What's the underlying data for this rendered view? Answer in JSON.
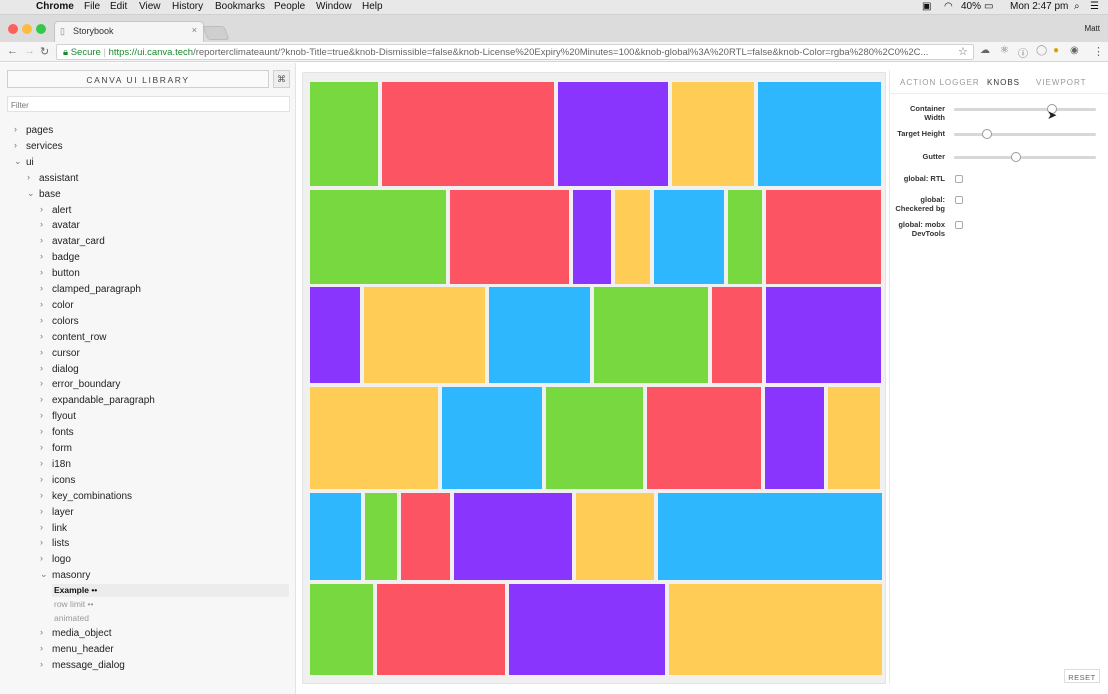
{
  "menubar": {
    "app": "Chrome",
    "menus": [
      "File",
      "Edit",
      "View",
      "History",
      "Bookmarks",
      "People",
      "Window",
      "Help"
    ],
    "battery": "40%",
    "clock": "Mon 2:47 pm",
    "user": "Matt"
  },
  "browser": {
    "tab_title": "Storybook",
    "secure_label": "Secure",
    "url_host": "https://ui.canva.tech",
    "url_path": "/reporterclimateaunt/?knob-Title=true&knob-Dismissible=false&knob-License%20Expiry%20Minutes=100&knob-global%3A%20RTL=false&knob-Color=rgba%280%2C0%2C..."
  },
  "sidebar": {
    "library_label": "CANVA UI LIBRARY",
    "shortcut_label": "⌘",
    "filter_placeholder": "Filter",
    "tree": [
      {
        "label": "pages",
        "depth": 0,
        "open": false
      },
      {
        "label": "services",
        "depth": 0,
        "open": false
      },
      {
        "label": "ui",
        "depth": 0,
        "open": true
      },
      {
        "label": "assistant",
        "depth": 1,
        "open": false
      },
      {
        "label": "base",
        "depth": 1,
        "open": true
      },
      {
        "label": "alert",
        "depth": 2,
        "open": false
      },
      {
        "label": "avatar",
        "depth": 2,
        "open": false
      },
      {
        "label": "avatar_card",
        "depth": 2,
        "open": false
      },
      {
        "label": "badge",
        "depth": 2,
        "open": false
      },
      {
        "label": "button",
        "depth": 2,
        "open": false
      },
      {
        "label": "clamped_paragraph",
        "depth": 2,
        "open": false
      },
      {
        "label": "color",
        "depth": 2,
        "open": false
      },
      {
        "label": "colors",
        "depth": 2,
        "open": false
      },
      {
        "label": "content_row",
        "depth": 2,
        "open": false
      },
      {
        "label": "cursor",
        "depth": 2,
        "open": false
      },
      {
        "label": "dialog",
        "depth": 2,
        "open": false
      },
      {
        "label": "error_boundary",
        "depth": 2,
        "open": false
      },
      {
        "label": "expandable_paragraph",
        "depth": 2,
        "open": false
      },
      {
        "label": "flyout",
        "depth": 2,
        "open": false
      },
      {
        "label": "fonts",
        "depth": 2,
        "open": false
      },
      {
        "label": "form",
        "depth": 2,
        "open": false
      },
      {
        "label": "i18n",
        "depth": 2,
        "open": false
      },
      {
        "label": "icons",
        "depth": 2,
        "open": false
      },
      {
        "label": "key_combinations",
        "depth": 2,
        "open": false
      },
      {
        "label": "layer",
        "depth": 2,
        "open": false
      },
      {
        "label": "link",
        "depth": 2,
        "open": false
      },
      {
        "label": "lists",
        "depth": 2,
        "open": false
      },
      {
        "label": "logo",
        "depth": 2,
        "open": false
      },
      {
        "label": "masonry",
        "depth": 2,
        "open": true
      }
    ],
    "stories": [
      {
        "label": "Example ••",
        "selected": true
      },
      {
        "label": "row limit ••",
        "selected": false
      },
      {
        "label": "animated",
        "selected": false
      }
    ],
    "tree_after": [
      {
        "label": "media_object",
        "depth": 2,
        "open": false
      },
      {
        "label": "menu_header",
        "depth": 2,
        "open": false
      },
      {
        "label": "message_dialog",
        "depth": 2,
        "open": false
      }
    ]
  },
  "colors": {
    "green": "#77d93f",
    "red": "#fd5463",
    "purple": "#8a35fe",
    "yellow": "#ffcc55",
    "blue": "#2fb7fe"
  },
  "masonry_rows": [
    [
      "green",
      "red",
      "purple",
      "yellow",
      "blue"
    ],
    [
      "green",
      "red",
      "purple",
      "yellow",
      "blue",
      "green",
      "red"
    ],
    [
      "purple",
      "yellow",
      "blue",
      "green",
      "red",
      "purple"
    ],
    [
      "yellow",
      "blue",
      "green",
      "red",
      "purple",
      "yellow"
    ],
    [
      "blue",
      "green",
      "red",
      "purple",
      "yellow",
      "blue"
    ],
    [
      "green",
      "red",
      "purple",
      "yellow"
    ]
  ],
  "panel": {
    "tabs": [
      "ACTION LOGGER",
      "KNOBS",
      "VIEWPORT"
    ],
    "active_tab": 1,
    "knobs": [
      {
        "label": "Container Width",
        "level": 0.69
      },
      {
        "label": "Target Height",
        "level": 0.23
      },
      {
        "label": "Gutter",
        "level": 0.44
      }
    ],
    "checkboxes": [
      {
        "label": "global: RTL",
        "checked": false
      },
      {
        "label": "global: Checkered bg",
        "checked": false
      },
      {
        "label": "global: mobx DevTools",
        "checked": false
      }
    ],
    "reset_label": "RESET"
  }
}
